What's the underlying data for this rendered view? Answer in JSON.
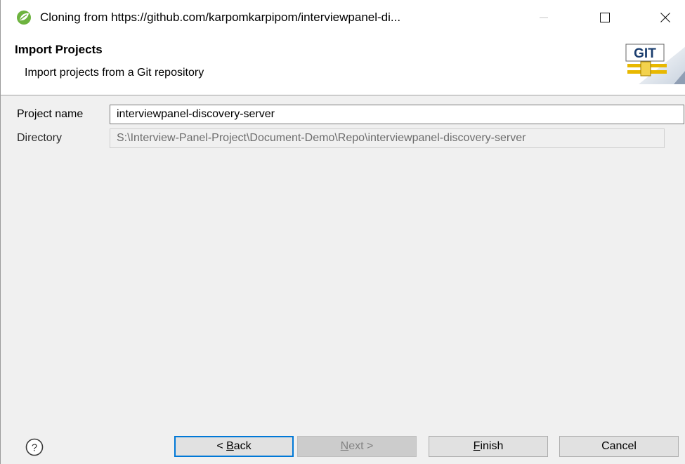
{
  "window": {
    "title": "Cloning from https://github.com/karpomkarpipom/interviewpanel-di...",
    "app_icon": "spring-leaf-icon",
    "controls": [
      "minimize-icon",
      "maximize-icon",
      "close-icon"
    ]
  },
  "header": {
    "title": "Import Projects",
    "description": "Import projects from a Git repository",
    "logo_text": "GIT"
  },
  "form": {
    "project_name_label": "Project name",
    "project_name_value": "interviewpanel-discovery-server",
    "directory_label": "Directory",
    "directory_value": "S:\\Interview-Panel-Project\\Document-Demo\\Repo\\interviewpanel-discovery-server"
  },
  "footer": {
    "help_icon": "question-mark-icon",
    "back": {
      "mnemonic": "B",
      "rest": "ack",
      "prefix": "< "
    },
    "next": {
      "mnemonic": "N",
      "rest": "ext",
      "suffix": " >"
    },
    "finish": {
      "mnemonic": "F",
      "rest": "inish"
    },
    "cancel_label": "Cancel"
  },
  "colors": {
    "focus_border": "#0078d7",
    "spring_green": "#6db33f",
    "git_gold": "#e8b800"
  }
}
